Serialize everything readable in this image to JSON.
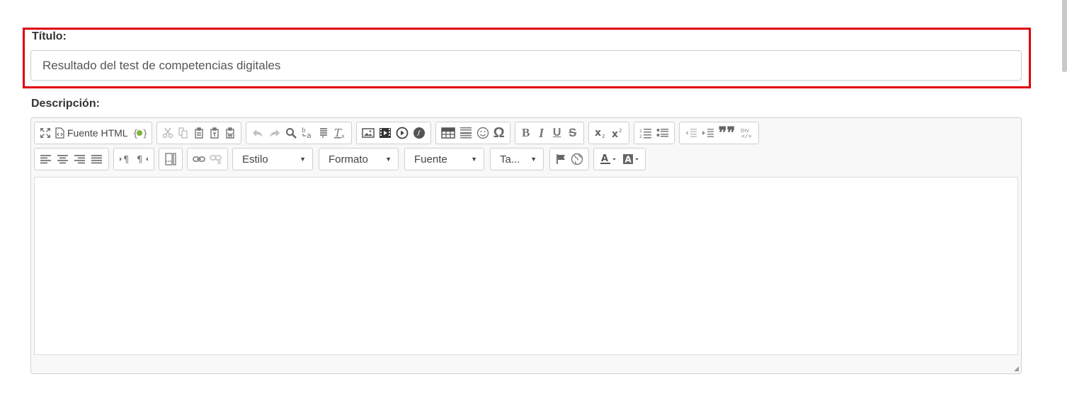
{
  "form": {
    "title_label": "Título:",
    "title_value": "Resultado del test de competencias digitales",
    "description_label": "Descripción:"
  },
  "toolbar": {
    "source_label": "Fuente HTML",
    "combos": {
      "style": "Estilo",
      "format": "Formato",
      "font": "Fuente",
      "size": "Ta..."
    },
    "div_label": "DIV"
  },
  "colors": {
    "highlight": "#e0000d",
    "icon": "#777777",
    "icon_disabled": "#c4c4c4"
  }
}
